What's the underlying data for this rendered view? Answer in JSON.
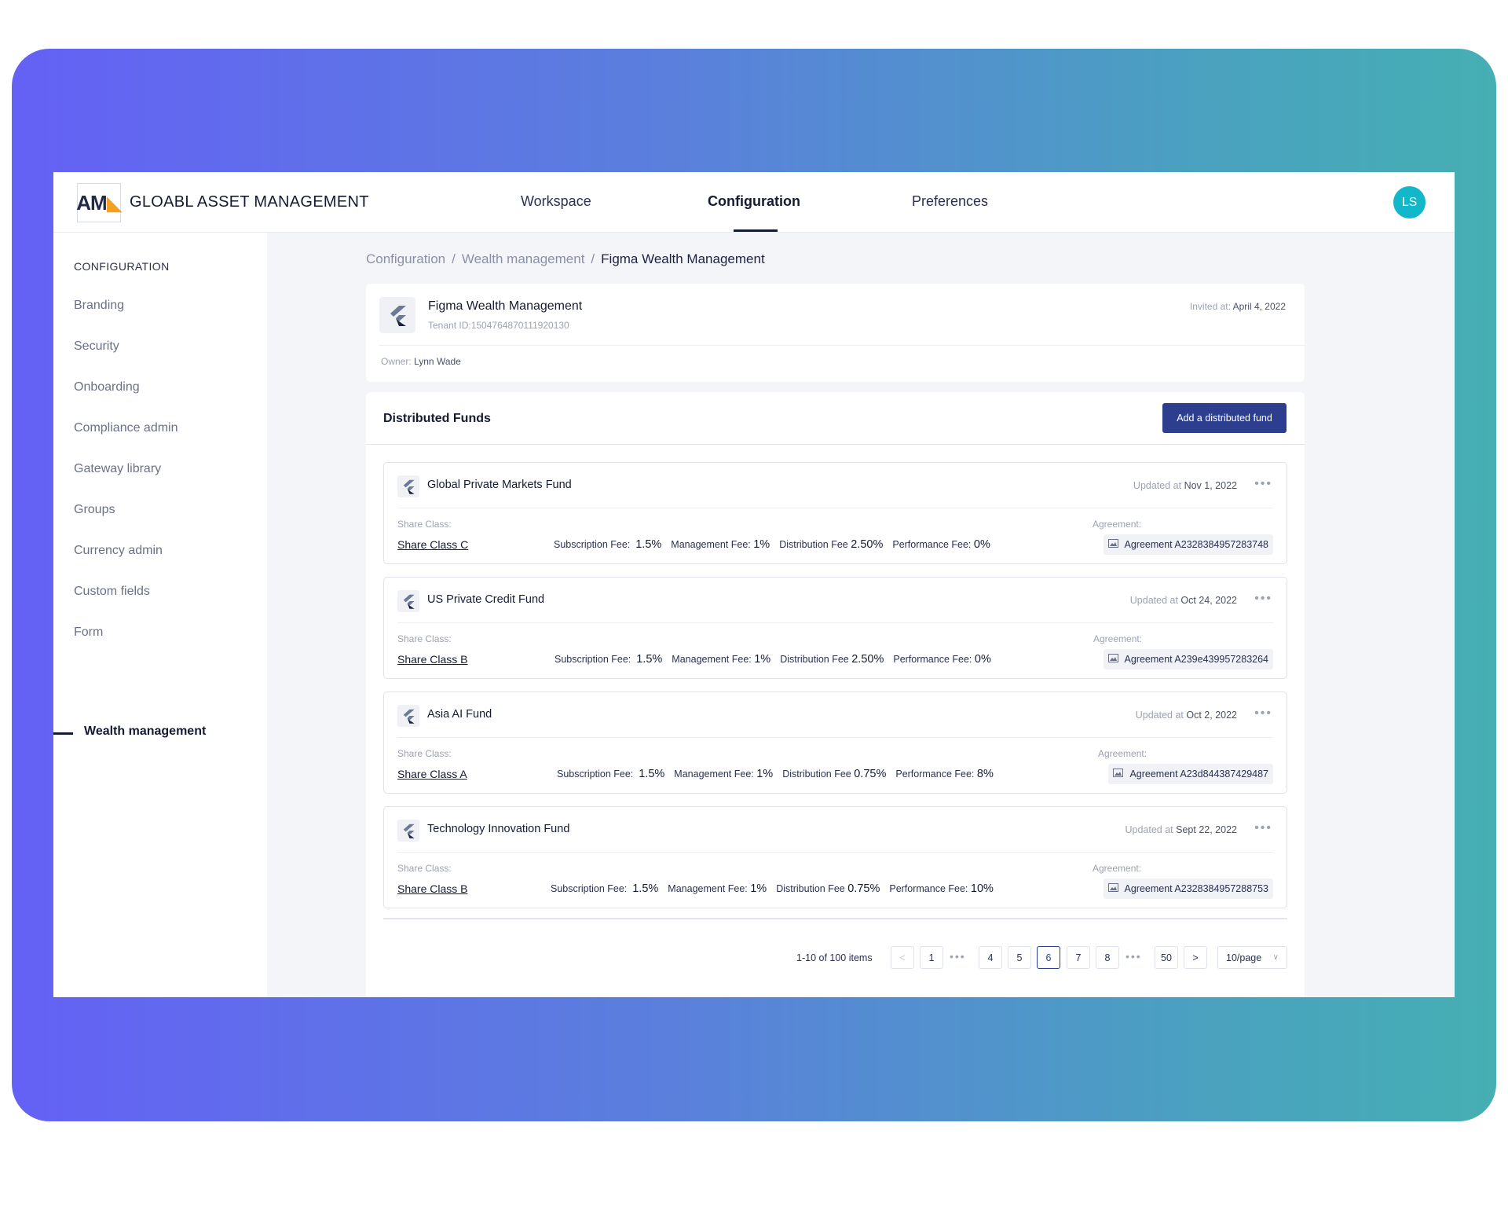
{
  "header": {
    "logo_text": "AM",
    "brand_name": "GLOABL ASSET MANAGEMENT",
    "tabs": [
      {
        "label": "Workspace"
      },
      {
        "label": "Configuration"
      },
      {
        "label": "Preferences"
      }
    ],
    "avatar_initials": "LS"
  },
  "sidebar": {
    "title": "CONFIGURATION",
    "items": [
      {
        "label": "Branding"
      },
      {
        "label": "Security"
      },
      {
        "label": "Onboarding"
      },
      {
        "label": "Compliance admin"
      },
      {
        "label": "Gateway library"
      },
      {
        "label": "Groups"
      },
      {
        "label": "Currency admin"
      },
      {
        "label": "Custom fields"
      },
      {
        "label": "Form"
      },
      {
        "label": "Wealth management"
      }
    ]
  },
  "breadcrumb": {
    "items": [
      "Configuration",
      "Wealth management",
      "Figma Wealth Management"
    ],
    "separator": "/"
  },
  "tenant": {
    "name": "Figma Wealth Management",
    "tenant_id": "Tenant ID:1504764870111920130",
    "invited_label": "Invited at:",
    "invited_date": "April 4, 2022",
    "owner_label": "Owner:",
    "owner_name": "Lynn Wade"
  },
  "funds": {
    "title": "Distributed Funds",
    "add_button": "Add a distributed fund",
    "share_class_label": "Share Class:",
    "agreement_label": "Agreement:",
    "updated_label": "Updated at",
    "fee_labels": {
      "subscription": "Subscription Fee:",
      "management": "Management Fee:",
      "distribution": "Distribution Fee",
      "performance": "Performance Fee:"
    },
    "items": [
      {
        "name": "Global Private Markets Fund",
        "updated": "Nov  1, 2022",
        "share_class": "Share Class C",
        "subscription": "1.5%",
        "management": "1%",
        "distribution": "2.50%",
        "performance": "0%",
        "agreement": "Agreement A2328384957283748"
      },
      {
        "name": "US Private Credit Fund",
        "updated": "Oct 24, 2022",
        "share_class": "Share Class B",
        "subscription": "1.5%",
        "management": "1%",
        "distribution": "2.50%",
        "performance": "0%",
        "agreement": "Agreement A239e439957283264"
      },
      {
        "name": "Asia AI Fund",
        "updated": "Oct 2, 2022",
        "share_class": "Share Class A",
        "subscription": "1.5%",
        "management": "1%",
        "distribution": "0.75%",
        "performance": "8%",
        "agreement": "Agreement A23d844387429487"
      },
      {
        "name": "Technology Innovation Fund",
        "updated": "Sept 22, 2022",
        "share_class": "Share Class B",
        "subscription": "1.5%",
        "management": "1%",
        "distribution": "0.75%",
        "performance": "10%",
        "agreement": "Agreement A2328384957288753"
      }
    ]
  },
  "pagination": {
    "total_text": "1-10 of 100 items",
    "prev": "<",
    "next": ">",
    "pages": [
      "1",
      "4",
      "5",
      "6",
      "7",
      "8",
      "50"
    ],
    "current_page": "6",
    "ellipsis": "•••",
    "page_size": "10/page"
  }
}
